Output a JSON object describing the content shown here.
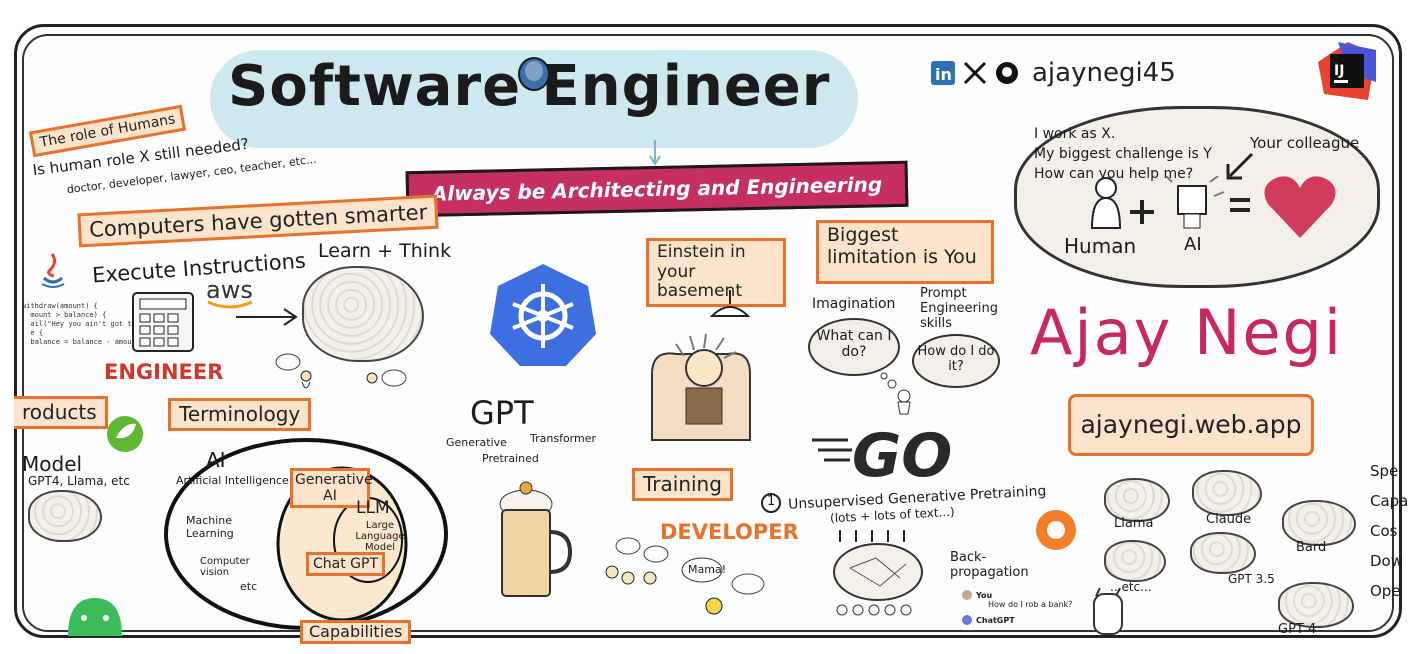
{
  "title": "Software Engineer",
  "tagline": "Always be Architecting and Engineering",
  "handle": "ajaynegi45",
  "name": "Ajay Negi",
  "website": "ajaynegi.web.app",
  "role_of_humans": {
    "title": "The role of Humans",
    "question": "Is human role X still needed?",
    "examples": "doctor, developer, lawyer, ceo, teacher, etc..."
  },
  "computers_smarter": "Computers have gotten smarter",
  "execute_instructions": "Execute Instructions",
  "learn_think": "Learn + Think",
  "aws": "aws",
  "engineer": "ENGINEER",
  "developer": "DEVELOPER",
  "products": "roducts",
  "model": {
    "label": "Model",
    "examples": "GPT4, Llama, etc"
  },
  "terminology": "Terminology",
  "ai_diagram": {
    "ai": "AI",
    "ai_full": "Artificial Intelligence",
    "machine_learning": "Machine Learning",
    "computer_vision": "Computer vision",
    "etc": "etc",
    "generative_ai": "Generative AI",
    "llm": "LLM",
    "llm_full": "Large Language Model",
    "chatgpt": "Chat GPT"
  },
  "capabilities": "Capabilities",
  "gpt": {
    "label": "GPT",
    "generative": "Generative",
    "pretrained": "Pretrained",
    "transformer": "Transformer"
  },
  "einstein": "Einstein in your basement",
  "training": "Training",
  "mama": "Mama!",
  "limitation": "Biggest limitation is You",
  "imagination": "Imagination",
  "prompt_skills": "Prompt Engineering skills",
  "what_can_i_do": "What can I do?",
  "how_do_i_do_it": "How do I do it?",
  "pretraining": {
    "step": "1",
    "title": "Unsupervised Generative Pretraining",
    "note": "(lots + lots of text...)",
    "backprop": "Back-propagation"
  },
  "colleague_bubble": {
    "line1": "I work as X.",
    "line2": "My biggest challenge is Y",
    "line3": "How can you help me?",
    "your_colleague": "Your colleague",
    "human": "Human",
    "ai": "AI"
  },
  "models": [
    "Llama",
    "Claude",
    "Bard",
    "GPT 3.5",
    "...etc...",
    "GPT 4"
  ],
  "right_edge": [
    "Spe",
    "Capa",
    "Cos",
    "Dow",
    "Ope"
  ],
  "chat": {
    "user": "You",
    "question": "How do I rob a bank?",
    "bot": "ChatGPT"
  },
  "code_lines": "withdraw(amount) {\n  mount > balance) {\n  ail(\"Hey you ain't got the cash!\")\n  e {\n  balance = balance - amount",
  "colors": {
    "accent": "#c62f62",
    "orange": "#e8722a",
    "bubble": "#cde8ee",
    "heart": "#d23c5c",
    "kube": "#3d6fe0"
  }
}
